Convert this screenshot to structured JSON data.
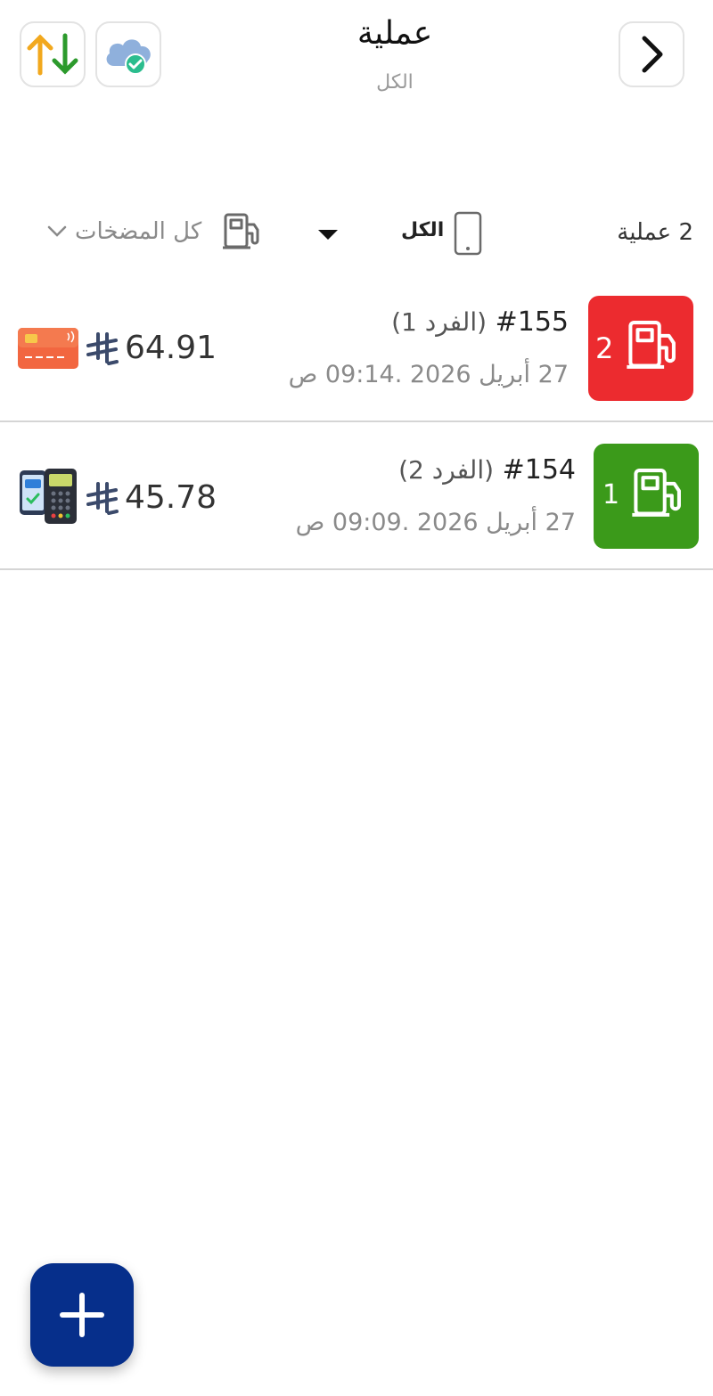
{
  "header": {
    "title": "عملية",
    "subtitle": "الكل",
    "icons": {
      "sync": "up-down-arrows-icon",
      "cloud": "cloud-check-icon",
      "next": "chevron-right-icon"
    }
  },
  "filters": {
    "count_label": "2 عملية",
    "device_label": "الكل",
    "pumps_label": "كل المضخات"
  },
  "transactions": [
    {
      "pump_number": "2",
      "pump_color": "#ec2b2f",
      "id": "#155",
      "shift": "(الفرد 1)",
      "date": "27 أبريل 2026 .09:14 ص",
      "amount": "64.91",
      "payment_icon": "credit-card-icon"
    },
    {
      "pump_number": "1",
      "pump_color": "#3b9a1a",
      "id": "#154",
      "shift": "(الفرد 2)",
      "date": "27 أبريل 2026 .09:09 ص",
      "amount": "45.78",
      "payment_icon": "pos-terminal-icon"
    }
  ],
  "fab": {
    "icon": "plus-icon",
    "color": "#062f8b"
  }
}
